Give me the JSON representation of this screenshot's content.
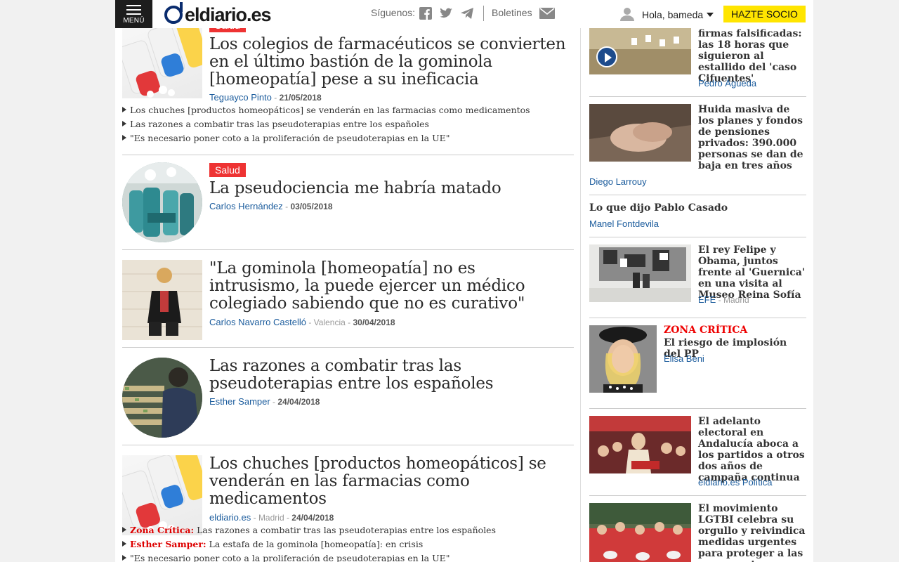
{
  "header": {
    "menu_label": "MENÚ",
    "logo_text": "eldiario.es",
    "follow_label": "Síguenos:",
    "newsletters_label": "Boletines",
    "greeting": "Hola, bameda",
    "cta_label": "HAZTE SOCIO"
  },
  "main": {
    "articles": [
      {
        "tag": "Salud",
        "headline": "Los colegios de farmacéuticos se convierten en el último bastión de la gominola [homeopatía] pese a su ineficacia",
        "author": "Teguayco Pinto",
        "date": "21/05/2018",
        "related": [
          "Los chuches [productos homeopáticos] se venderán en las farmacias como medicamentos",
          "Las razones a combatir tras las pseudoterapias entre los españoles",
          "\"Es necesario poner coto a la proliferación de pseudoterapias en la UE\""
        ]
      },
      {
        "tag": "Salud",
        "headline": "La pseudociencia me habría matado",
        "author": "Carlos Hernández",
        "date": "03/05/2018"
      },
      {
        "headline": "\"La gominola [homeopatía] no es intrusismo, la puede ejercer un médico colegiado sabiendo que no es curativo\"",
        "author": "Carlos Navarro Castelló",
        "location": "Valencia",
        "date": "30/04/2018"
      },
      {
        "headline": "Las razones a combatir tras las pseudoterapias entre los españoles",
        "author": "Esther Samper",
        "date": "24/04/2018"
      },
      {
        "headline": "Los chuches [productos homeopáticos] se venderán en las farmacias como medicamentos",
        "author": "eldiario.es",
        "location": "Madrid",
        "date": "24/04/2018",
        "related": [
          {
            "highlight": "Zona Crítica:",
            "text": " Las razones a combatir tras las pseudoterapias entre los españoles"
          },
          {
            "highlight": "Esther Samper:",
            "text": " La estafa de la gominola [homeopatía]: en crisis"
          },
          {
            "highlight": "",
            "text": "\"Es necesario poner coto a la proliferación de pseudoterapias en la UE\""
          }
        ]
      }
    ]
  },
  "sidebar": {
    "items": [
      {
        "title": "firmas falsificadas: las 18 horas que siguieron al estallido del 'caso Cifuentes'",
        "author": "Pedro Águeda"
      },
      {
        "title": "Huida masiva de los planes y fondos de pensiones privados: 390.000 personas se dan de baja en tres años",
        "author": "Diego Larrouy"
      },
      {
        "title": "Lo que dijo Pablo Casado",
        "author": "Manel Fontdevila"
      },
      {
        "title": "El rey Felipe y Obama, juntos frente al 'Guernica' en una visita al Museo Reina Sofía",
        "author": "EFE",
        "location": "Madrid"
      },
      {
        "section": "ZONA CRÍTICA",
        "title": "El riesgo de implosión del PP",
        "author": "Elisa Beni"
      },
      {
        "title": "El adelanto electoral en Andalucía aboca a los partidos a otros dos años de campaña continua",
        "author": "eldiario.es Política"
      },
      {
        "title": "El movimiento LGTBI celebra su orgullo y reivindica medidas urgentes para proteger a las personas trans"
      }
    ]
  },
  "colors": {
    "tag_red": "#ee3333",
    "link_blue": "#1a5b9c",
    "cta_yellow": "#ffe500",
    "logo_navy": "#0a2c6e"
  },
  "icons": [
    "menu-icon",
    "facebook-icon",
    "twitter-icon",
    "telegram-icon",
    "mail-icon",
    "user-icon",
    "caret-down-icon",
    "play-icon"
  ]
}
